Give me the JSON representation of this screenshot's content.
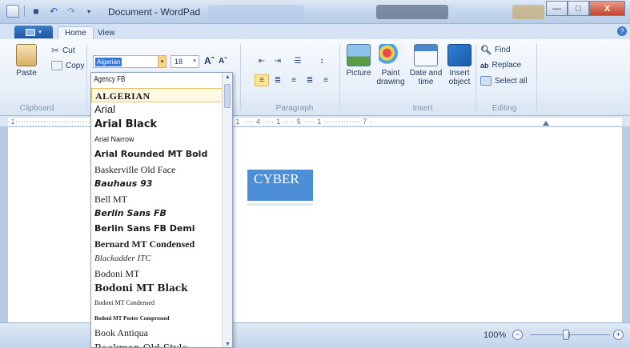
{
  "window": {
    "title": "Document - WordPad"
  },
  "qat": {
    "app_icon": "wordpad-app-icon",
    "save_icon": "save-icon",
    "undo_icon": "undo-icon",
    "redo_icon": "redo-icon",
    "customize_icon": "dropdown-arrow-icon"
  },
  "window_controls": {
    "minimize": "—",
    "maximize": "□",
    "close": "X"
  },
  "tabs": {
    "file": "",
    "home": "Home",
    "view": "View"
  },
  "ribbon": {
    "clipboard": {
      "paste": "Paste",
      "cut": "Cut",
      "copy": "Copy",
      "group": "Clipboard"
    },
    "font": {
      "name_value": "Algerian",
      "size_value": "18",
      "grow": "Aˆ",
      "shrink": "Aˇ"
    },
    "paragraph": {
      "group": "Paragraph",
      "increase_indent": "⇥",
      "decrease_indent": "⇤",
      "bullets": "☰",
      "spacing": "↕",
      "align_left": "≡",
      "align_center": "≣",
      "align_right": "≡",
      "justify": "≣"
    },
    "insert": {
      "picture": "Picture",
      "paint": "Paint\ndrawing",
      "datetime": "Date and\ntime",
      "object": "Insert\nobject",
      "group": "Insert"
    },
    "editing": {
      "find": "Find",
      "replace": "Replace",
      "select_all": "Select all",
      "group": "Editing"
    }
  },
  "ruler": {
    "scale": "·1························································ 2 ···· 1 ···· 3 ···· 1 ···· 4 ···· 1 ···· 5 ···· 1 ············· 7 ·"
  },
  "document": {
    "text": "CYBER"
  },
  "status": {
    "zoom": "100%",
    "zoom_out": "−",
    "zoom_in": "+"
  },
  "font_list": {
    "items": [
      "Agency FB",
      "ALGERIAN",
      "Arial",
      "Arial Black",
      "Arial Narrow",
      "Arial Rounded MT Bold",
      "Baskerville Old Face",
      "Bauhaus 93",
      "Bell MT",
      "Berlin Sans FB",
      "Berlin Sans FB Demi",
      "Bernard MT Condensed",
      "Blackadder ITC",
      "Bodoni MT",
      "Bodoni MT Black",
      "Bodoni MT Condensed",
      "Bodoni MT Poster Compressed",
      "Book Antiqua",
      "Bookman Old Style"
    ]
  },
  "colors": {
    "selection": "#3478d8",
    "text_highlight": "#4c8fd6",
    "ribbon_bg": "#e6eef8",
    "accent": "#1e56a3"
  }
}
